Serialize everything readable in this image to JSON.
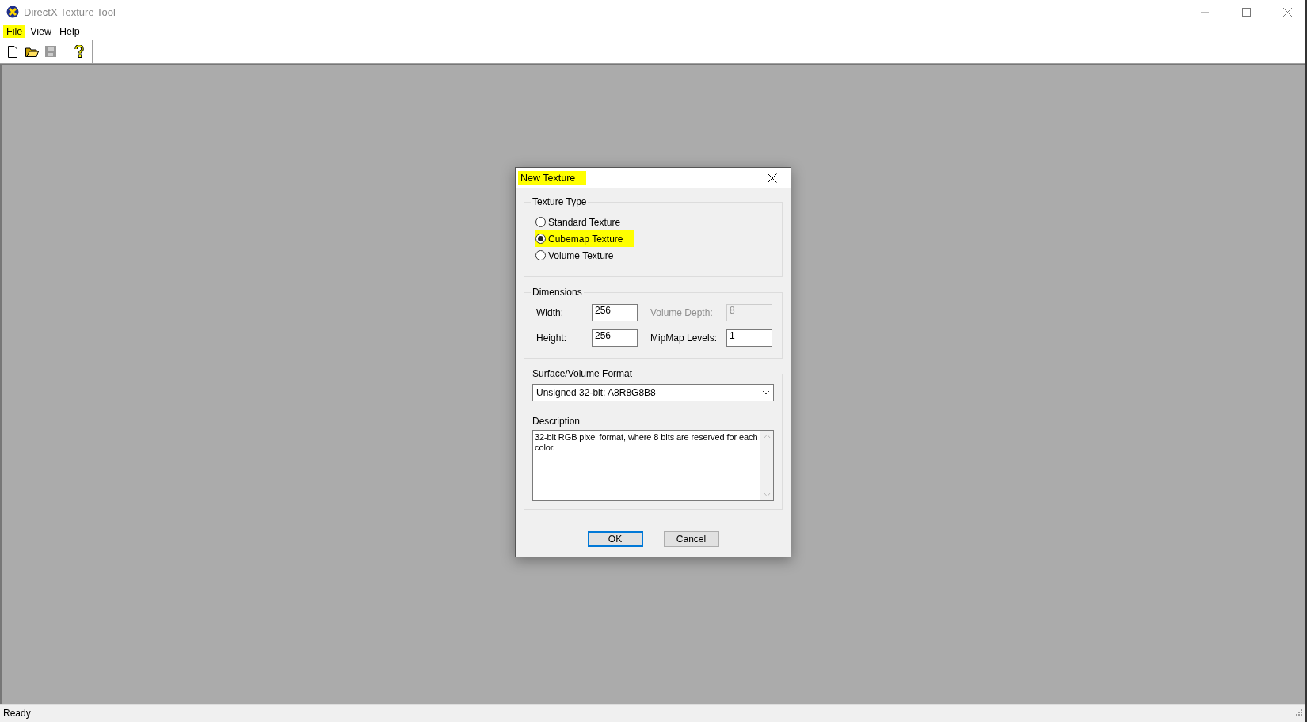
{
  "window": {
    "title": "DirectX Texture Tool"
  },
  "menu": [
    {
      "label": "File",
      "highlighted": true
    },
    {
      "label": "View",
      "highlighted": false
    },
    {
      "label": "Help",
      "highlighted": false
    }
  ],
  "dialog": {
    "title": "New Texture",
    "title_highlighted": true,
    "texture_type": {
      "label": "Texture Type",
      "options": [
        {
          "label": "Standard Texture",
          "selected": false,
          "highlighted": false
        },
        {
          "label": "Cubemap Texture",
          "selected": true,
          "highlighted": true
        },
        {
          "label": "Volume Texture",
          "selected": false,
          "highlighted": false
        }
      ]
    },
    "dimensions": {
      "label": "Dimensions",
      "fields": [
        {
          "label": "Width:",
          "value": "256",
          "disabled": false
        },
        {
          "label": "Volume Depth:",
          "value": "8",
          "disabled": true
        },
        {
          "label": "Height:",
          "value": "256",
          "disabled": false
        },
        {
          "label": "MipMap Levels:",
          "value": "1",
          "disabled": false
        }
      ]
    },
    "format": {
      "label": "Surface/Volume Format",
      "value": "Unsigned 32-bit: A8R8G8B8"
    },
    "description": {
      "label": "Description",
      "text": "32-bit RGB pixel format, where 8 bits are reserved for each color."
    },
    "buttons": [
      {
        "label": "OK",
        "default": true
      },
      {
        "label": "Cancel",
        "default": false
      }
    ]
  },
  "status_bar": {
    "text": "Ready"
  }
}
